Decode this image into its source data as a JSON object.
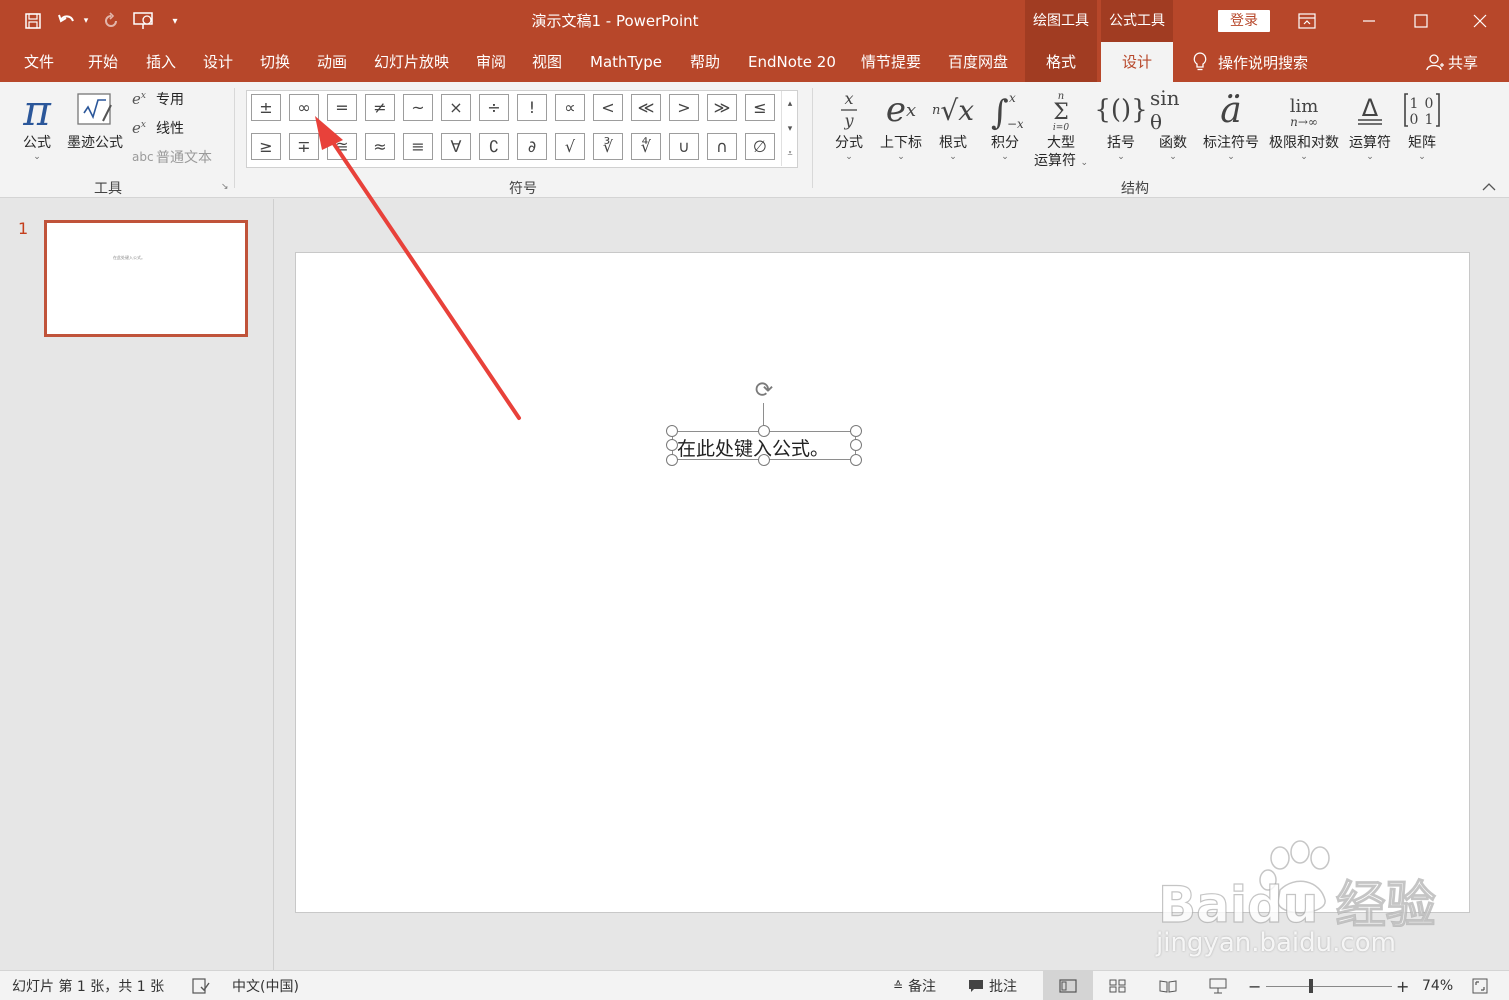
{
  "title_bar": {
    "document_title": "演示文稿1  -  PowerPoint",
    "context_tab_drawing": "绘图工具",
    "context_tab_equation": "公式工具",
    "login_label": "登录",
    "qat_icons": [
      "save-icon",
      "undo-icon",
      "redo-icon",
      "present-from-start-icon",
      "customize-qat-icon"
    ]
  },
  "tabs": {
    "file": "文件",
    "home": "开始",
    "insert": "插入",
    "design": "设计",
    "transitions": "切换",
    "animations": "动画",
    "slideshow": "幻灯片放映",
    "review": "审阅",
    "view": "视图",
    "mathtype": "MathType",
    "help": "帮助",
    "endnote": "EndNote 20",
    "storyline": "情节提要",
    "baidu": "百度网盘",
    "format": "格式",
    "eq_design": "设计",
    "tell_me": "操作说明搜索",
    "share": "共享"
  },
  "ribbon": {
    "tools": {
      "label": "工具",
      "equation": "公式",
      "ink_equation": "墨迹公式",
      "professional": "专用",
      "linear": "线性",
      "normal_text": "普通文本"
    },
    "symbols": {
      "label": "符号",
      "row1": [
        "±",
        "∞",
        "=",
        "≠",
        "~",
        "×",
        "÷",
        "!",
        "∝",
        "<",
        "≪",
        ">",
        "≫",
        "≤"
      ],
      "row2": [
        "≥",
        "∓",
        "≅",
        "≈",
        "≡",
        "∀",
        "∁",
        "∂",
        "√",
        "∛",
        "∜",
        "∪",
        "∩",
        "∅"
      ]
    },
    "structures": {
      "label": "结构",
      "fraction": "分式",
      "script": "上下标",
      "radical": "根式",
      "integral": "积分",
      "large_operator_1": "大型",
      "large_operator_2": "运算符",
      "bracket": "括号",
      "function": "函数",
      "accent": "标注符号",
      "limit_log": "极限和对数",
      "operator": "运算符",
      "matrix": "矩阵"
    }
  },
  "thumbnails": {
    "slide_number": "1",
    "thumb_text": "在此处键入公式。"
  },
  "slide": {
    "equation_placeholder": "在此处键入公式。"
  },
  "watermark": {
    "brand": "Baidu 经验",
    "url": "jingyan.baidu.com"
  },
  "status_bar": {
    "slide_info": "幻灯片 第 1 张，共 1 张",
    "language": "中文(中国)",
    "notes": "备注",
    "comments": "批注",
    "zoom_minus": "−",
    "zoom_plus": "+",
    "zoom_level": "74%"
  },
  "colors": {
    "accent": "#b7472a",
    "context_tab": "#a13c22",
    "arrow": "#e8413a"
  }
}
